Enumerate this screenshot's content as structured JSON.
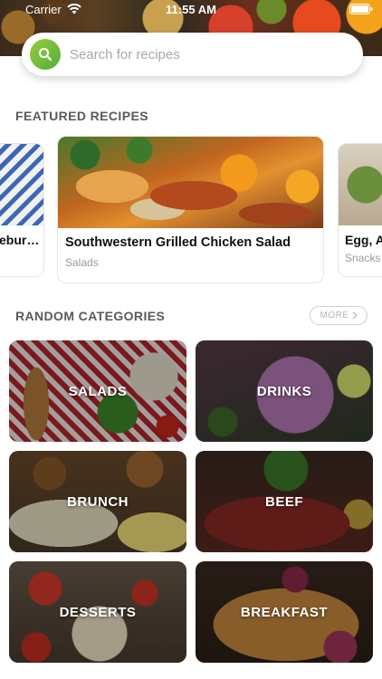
{
  "status_bar": {
    "carrier": "Carrier",
    "time": "11:55 AM"
  },
  "search": {
    "placeholder": "Search for recipes"
  },
  "featured": {
    "title": "FEATURED RECIPES",
    "cards": [
      {
        "title": "ebur…",
        "subtitle": ""
      },
      {
        "title": "Southwestern Grilled Chicken Salad",
        "subtitle": "Salads"
      },
      {
        "title": "Egg, Ar",
        "subtitle": "Snacks"
      }
    ]
  },
  "categories": {
    "title": "RANDOM CATEGORIES",
    "more_label": "MORE",
    "items": [
      {
        "label": "SALADS"
      },
      {
        "label": "DRINKS"
      },
      {
        "label": "BRUNCH"
      },
      {
        "label": "BEEF"
      },
      {
        "label": "DESSERTS"
      },
      {
        "label": "BREAKFAST"
      }
    ]
  },
  "colors": {
    "accent": "#5cb83b",
    "section_title": "#5a5a5a"
  },
  "icons": [
    "wifi-icon",
    "battery-icon",
    "search-icon",
    "chevron-right-icon"
  ]
}
